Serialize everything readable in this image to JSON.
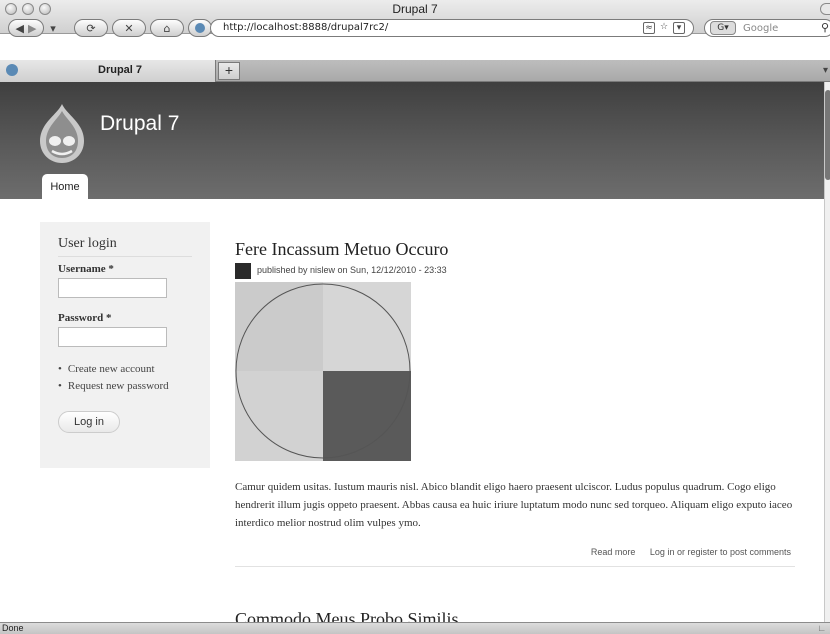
{
  "window": {
    "title": "Drupal 7"
  },
  "toolbar": {
    "url": "http://localhost:8888/drupal7rc2/",
    "search_placeholder": "Google"
  },
  "tabs": [
    {
      "label": "Drupal 7"
    }
  ],
  "site": {
    "name": "Drupal 7",
    "nav": [
      {
        "label": "Home"
      }
    ]
  },
  "login": {
    "title": "User login",
    "username_label": "Username",
    "password_label": "Password",
    "required_mark": "*",
    "links": [
      "Create new account",
      "Request new password"
    ],
    "button": "Log in"
  },
  "article": {
    "title": "Fere Incassum Metuo Occuro",
    "meta": "published by nislew on Sun, 12/12/2010 - 23:33",
    "body": "Camur quidem usitas. Iustum mauris nisl. Abico blandit eligo haero praesent ulciscor. Ludus populus quadrum. Cogo eligo hendrerit illum jugis oppeto praesent. Abbas causa ea huic iriure luptatum modo nunc sed torqueo. Aliquam eligo exputo iaceo interdico melior nostrud olim vulpes ymo.",
    "read_more": "Read more",
    "comments": "Log in or register to post comments"
  },
  "next_article": {
    "title": "Commodo Meus Probo Similis"
  },
  "status": {
    "text": "Done"
  },
  "colors": {
    "header": "#4a4a4a",
    "sidebar": "#f1f1f1"
  }
}
